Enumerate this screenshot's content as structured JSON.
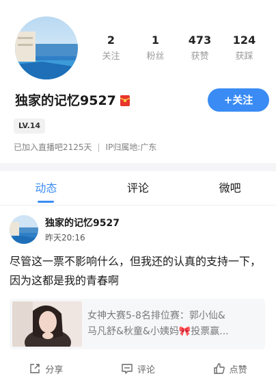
{
  "profile": {
    "username": "独家的记忆9527",
    "level": "LV.14",
    "joined": "已加入直播吧2125天",
    "ip_location": "IP归属地:广东",
    "follow_button": "+关注",
    "stats": [
      {
        "value": "2",
        "label": "关注"
      },
      {
        "value": "1",
        "label": "粉丝"
      },
      {
        "value": "473",
        "label": "获赞"
      },
      {
        "value": "124",
        "label": "获踩"
      }
    ]
  },
  "tabs": [
    {
      "label": "动态",
      "active": true
    },
    {
      "label": "评论",
      "active": false
    },
    {
      "label": "微吧",
      "active": false
    }
  ],
  "post": {
    "author": "独家的记忆9527",
    "time": "昨天20:16",
    "text": "尽管这一票不影响什么，但我还的认真的支持一下，因为这都是我的青春啊",
    "card_line1": "女神大赛5-8名排位赛：郭小仙&",
    "card_line2": "马凡舒&秋童&小姨妈🎀投票赢..."
  },
  "actions": {
    "share": "分享",
    "comment": "评论",
    "like": "点赞"
  },
  "colors": {
    "accent": "#3a8cf4",
    "badge_red": "#e8352b"
  }
}
